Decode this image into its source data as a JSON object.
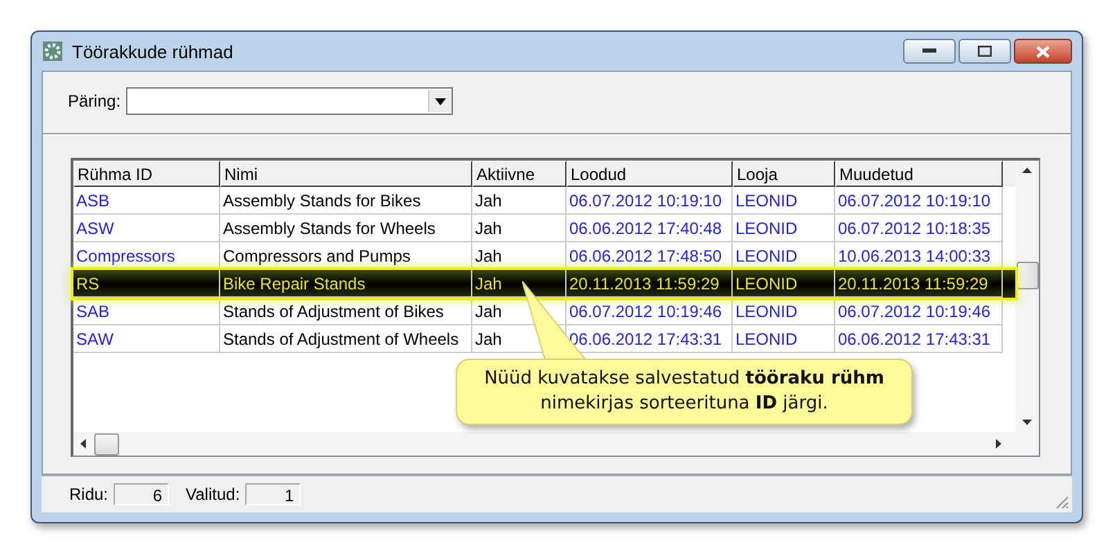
{
  "window": {
    "title": "Töörakkude rühmad"
  },
  "query": {
    "label": "Päring:"
  },
  "table": {
    "columns": [
      "Rühma ID",
      "Nimi",
      "Aktiivne",
      "Loodud",
      "Looja",
      "Muudetud"
    ],
    "rows": [
      {
        "selected": false,
        "cells": [
          "ASB",
          "Assembly Stands for Bikes",
          "Jah",
          "06.07.2012 10:19:10",
          "LEONID",
          "06.07.2012 10:19:10"
        ]
      },
      {
        "selected": false,
        "cells": [
          "ASW",
          "Assembly Stands for Wheels",
          "Jah",
          "06.06.2012 17:40:48",
          "LEONID",
          "06.07.2012 10:18:35"
        ]
      },
      {
        "selected": false,
        "cells": [
          "Compressors",
          "Compressors and Pumps",
          "Jah",
          "06.06.2012 17:48:50",
          "LEONID",
          "10.06.2013 14:00:33"
        ]
      },
      {
        "selected": true,
        "cells": [
          "RS",
          "Bike Repair Stands",
          "Jah",
          "20.11.2013 11:59:29",
          "LEONID",
          "20.11.2013 11:59:29"
        ]
      },
      {
        "selected": false,
        "cells": [
          "SAB",
          "Stands of Adjustment of Bikes",
          "Jah",
          "06.07.2012 10:19:46",
          "LEONID",
          "06.07.2012 10:19:46"
        ]
      },
      {
        "selected": false,
        "cells": [
          "SAW",
          "Stands of Adjustment of Wheels",
          "Jah",
          "06.06.2012 17:43:31",
          "LEONID",
          "06.06.2012 17:43:31"
        ]
      }
    ]
  },
  "callout": {
    "text": "Nüüd kuvatakse salvestatud **tööraku rühm** nimekirjas sorteerituna **ID** järgi."
  },
  "status_bar": [
    {
      "label": "Ridu:",
      "value": "6"
    },
    {
      "label": "Valitud:",
      "value": "1"
    }
  ]
}
